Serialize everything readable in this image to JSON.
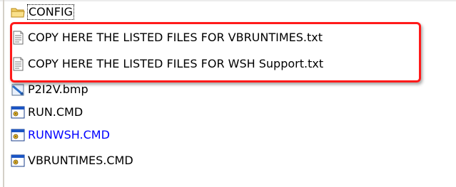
{
  "files": [
    {
      "name": "CONFIG",
      "icon": "folder-icon"
    },
    {
      "name": "COPY HERE THE LISTED FILES FOR VBRUNTIMES.txt",
      "icon": "text-document-icon"
    },
    {
      "name": "COPY HERE THE LISTED FILES FOR WSH Support.txt",
      "icon": "text-document-icon"
    },
    {
      "name": "P2I2V.bmp",
      "icon": "bitmap-image-icon"
    },
    {
      "name": "RUN.CMD",
      "icon": "cmd-script-icon"
    },
    {
      "name": "RUNWSH.CMD",
      "icon": "cmd-script-icon"
    },
    {
      "name": "VBRUNTIMES.CMD",
      "icon": "cmd-script-icon"
    }
  ],
  "colors": {
    "highlight_border": "#ff1a1a",
    "link_text": "#0000ff"
  }
}
